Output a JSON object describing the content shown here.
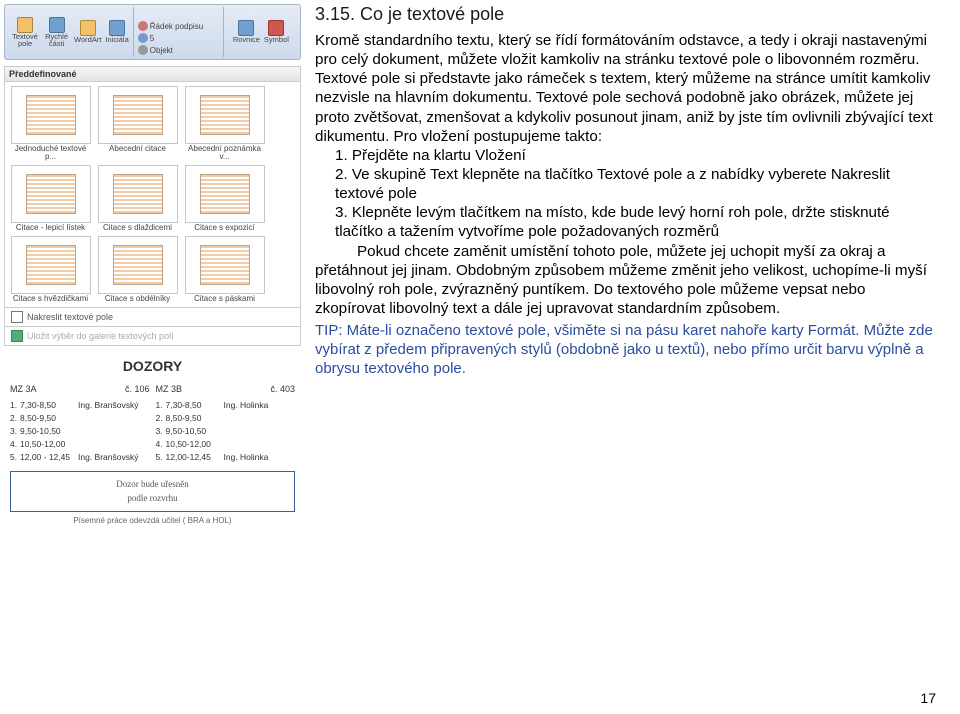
{
  "ribbon": {
    "group1": {
      "btn1": "Textové pole",
      "btn2": "Rychlé části",
      "btn3": "WordArt",
      "btn4": "Iniciála"
    },
    "group2_signature": "Řádek podpisu",
    "group2_datetime": "5",
    "group2_object": "Objekt",
    "group3": {
      "btn1": "Rovnice",
      "btn2": "Symbol"
    }
  },
  "gallery": {
    "header": "Předdefinované",
    "thumbs": [
      "Jednoduché textové p...",
      "Abecední citace",
      "Abecední poznámka v...",
      "Citace - lepicí lístek",
      "Citace s dlaždicemi",
      "Citace s expozicí",
      "Citace s hvězdičkami",
      "Citace s obdélníky",
      "Citace s páskami"
    ],
    "link1": "Nakreslit textové pole",
    "link2": "Uložit výběr do galerie textových polí"
  },
  "dozory": {
    "title": "DOZORY",
    "col1": {
      "class": "MZ 3A",
      "room": "č. 106",
      "rows": [
        {
          "n": "1.",
          "t": "7,30-8,50",
          "name": "Ing. Branšovský"
        },
        {
          "n": "2.",
          "t": "8,50-9,50",
          "name": ""
        },
        {
          "n": "3.",
          "t": "9,50-10,50",
          "name": ""
        },
        {
          "n": "4.",
          "t": "10,50-12,00",
          "name": ""
        },
        {
          "n": "5.",
          "t": "12,00 - 12,45",
          "name": "Ing. Branšovský"
        }
      ]
    },
    "col2": {
      "class": "MZ 3B",
      "room": "č. 403",
      "rows": [
        {
          "n": "1.",
          "t": "7,30-8,50",
          "name": "Ing. Holinka"
        },
        {
          "n": "2.",
          "t": "8,50-9,50",
          "name": ""
        },
        {
          "n": "3.",
          "t": "9,50-10,50",
          "name": ""
        },
        {
          "n": "4.",
          "t": "10,50-12,00",
          "name": ""
        },
        {
          "n": "5.",
          "t": "12,00-12,45",
          "name": "Ing. Holinka"
        }
      ]
    },
    "note_l1": "Dozor bude uřesněn",
    "note_l2": "podle rozvrhu",
    "footer": "Písemné práce odevzdá učitel ( BRA a HOL)"
  },
  "text": {
    "title": "3.15. Co je textové pole",
    "p1": "Kromě standardního textu, který se řídí formátováním odstavce, a tedy i okraji nastavenými pro celý dokument, můžete vložit kamkoliv na stránku textové pole o libovonném rozměru. Textové pole si představte jako rámeček s textem, který můžeme na stránce umítit kamkoliv nezvisle na hlavním dokumentu. Textové pole sechová podobně jako obrázek, můžete jej proto zvětšovat, zmenšovat a kdykoliv posunout jinam, aniž by jste tím ovlivnili zbývající text dikumentu. Pro vložení postupujeme takto:",
    "s1": "1. Přejděte na klartu Vložení",
    "s2": "2. Ve skupině Text klepněte na tlačítko Textové pole a z nabídky vyberete Nakreslit textové pole",
    "s3": "3. Klepněte levým tlačítkem na místo, kde bude levý horní roh pole, držte stisknuté tlačítko a tažením vytvoříme pole požadovaných rozměrů",
    "s3b": "Pokud chcete zaměnit umístění tohoto pole, můžete jej uchopit myší za okraj a přetáhnout jej jinam. Obdobným způsobem můžeme změnit jeho velikost, uchopíme-li myší libovolný roh pole, zvýrazněný puntíkem. Do textového pole můžeme vepsat nebo zkopírovat libovolný text a dále jej upravovat standardním způsobem.",
    "tip": "TIP: Máte-li označeno textové pole, všiměte si na pásu karet nahoře karty Formát. Můžte zde vybírat z předem připravených stylů (obdobně jako u textů), nebo přímo určit barvu výplně a obrysu textového pole.",
    "pagenum": "17"
  }
}
